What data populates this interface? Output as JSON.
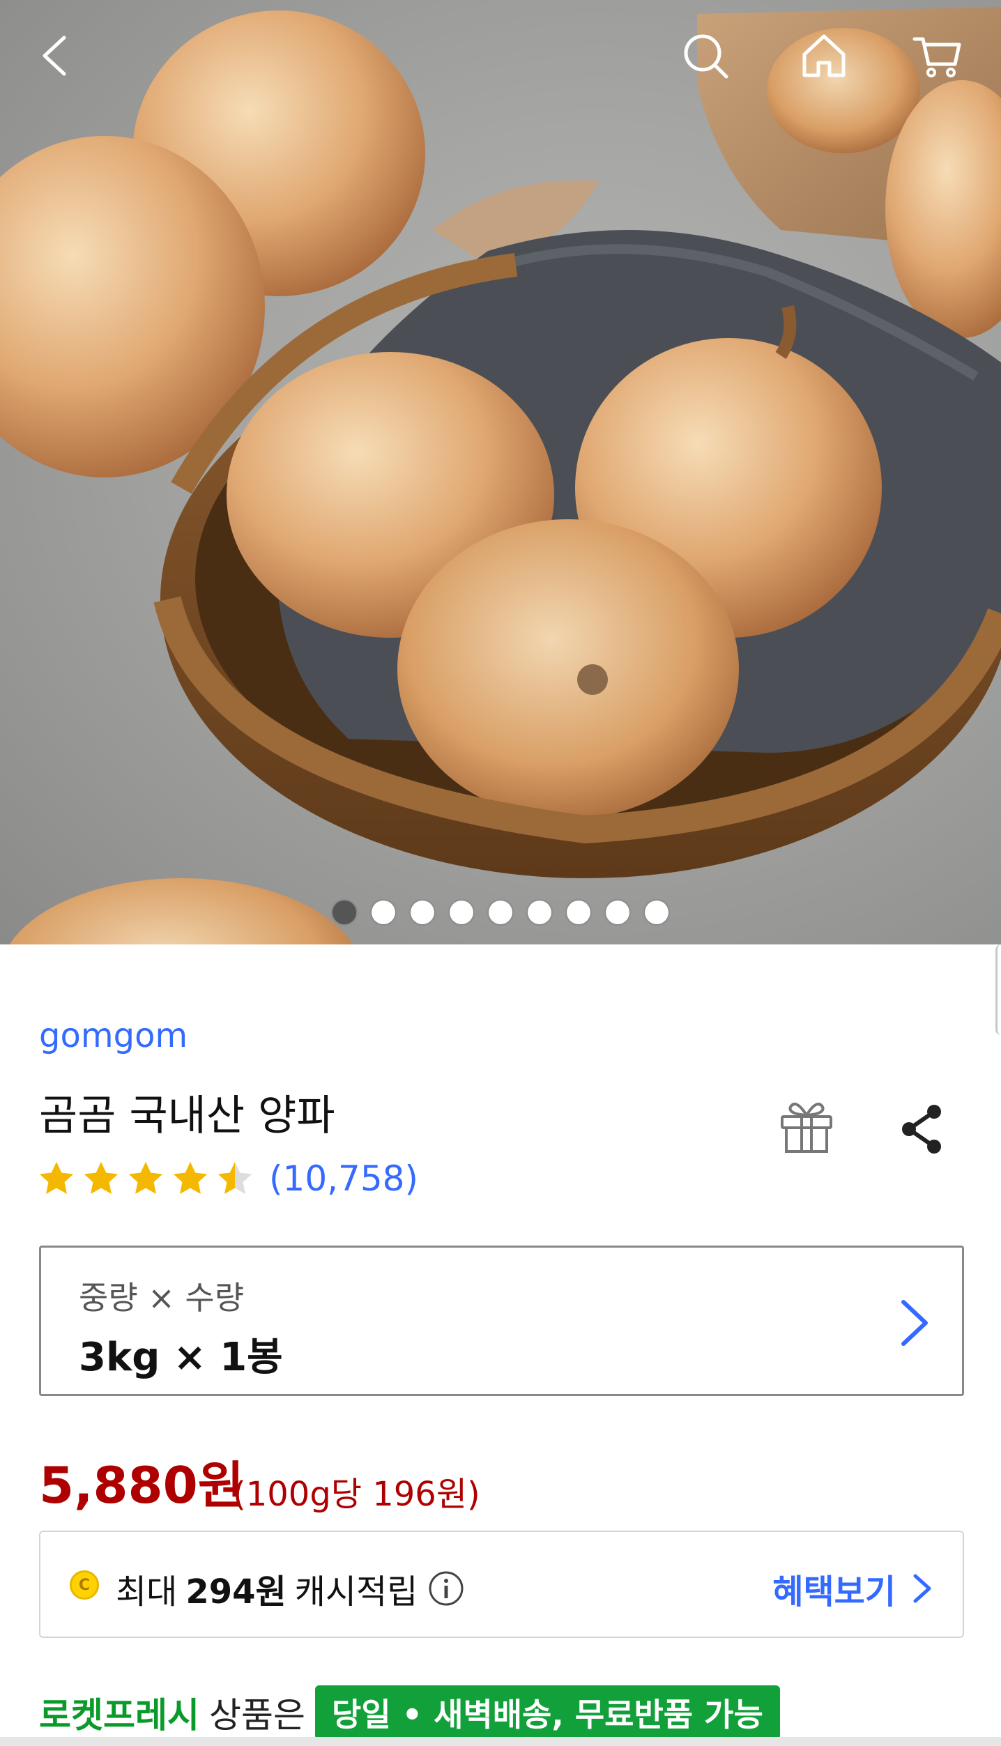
{
  "hero": {
    "image_description": "onion-basket-photo",
    "slide_count": 9,
    "active_slide": 1
  },
  "nav": {
    "back_icon": "chevron-left-icon",
    "search_icon": "search-icon",
    "home_icon": "home-icon",
    "cart_icon": "cart-icon"
  },
  "product": {
    "brand": "gomgom",
    "title": "곰곰 국내산 양파",
    "rating": 4.5,
    "review_count": "(10,758)"
  },
  "option": {
    "label": "중량 × 수량",
    "value": "3kg × 1봉"
  },
  "price": {
    "amount": "5,880원",
    "unit": "(100g당 196원)"
  },
  "cashback": {
    "prefix": "최대",
    "amount": "294원",
    "suffix": "캐시적립",
    "benefit_link": "혜택보기",
    "coin_letter": "C"
  },
  "fresh": {
    "brand": "로켓프레시",
    "text": "상품은",
    "badge": "당일 • 새벽배송, 무료반품 가능"
  },
  "colors": {
    "accent_blue": "#346aff",
    "price_red": "#ae0000",
    "fresh_green": "#12a03a"
  }
}
